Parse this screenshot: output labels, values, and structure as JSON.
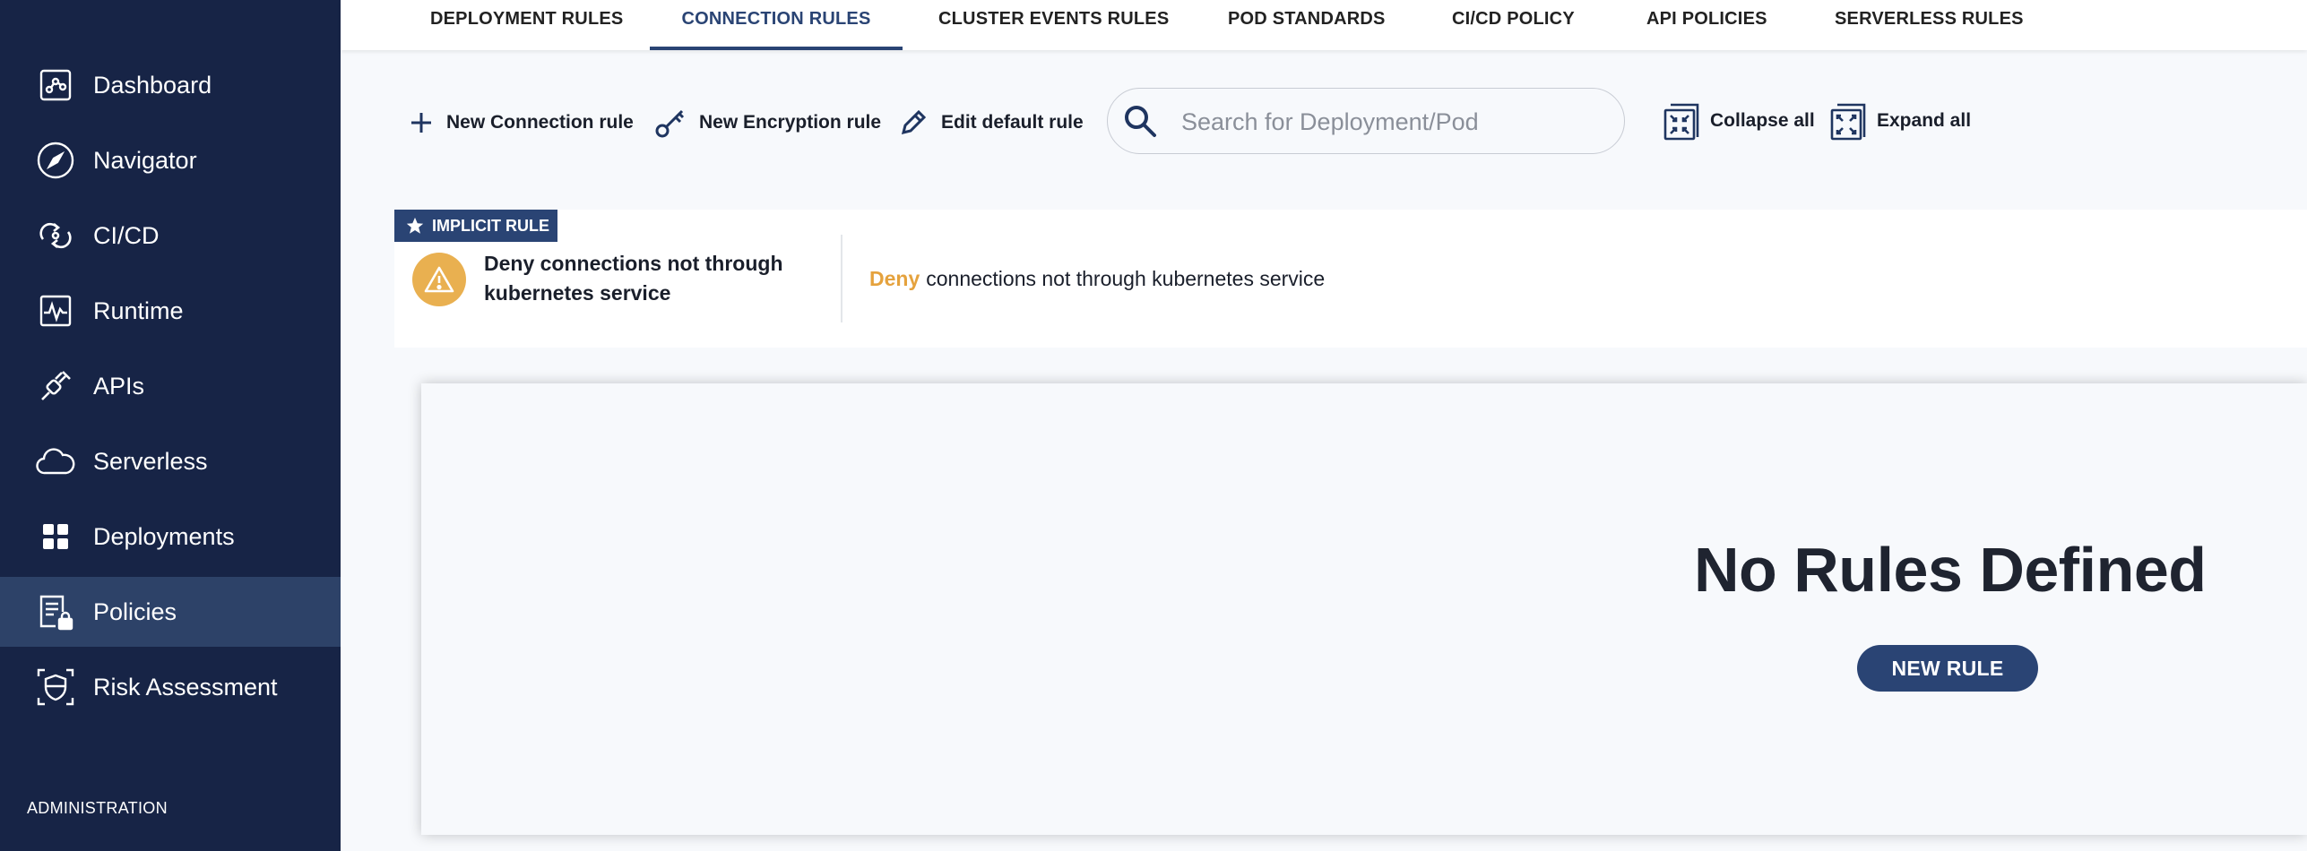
{
  "sidebar": {
    "items": [
      {
        "label": "Dashboard",
        "icon": "dashboard-icon"
      },
      {
        "label": "Navigator",
        "icon": "compass-icon"
      },
      {
        "label": "CI/CD",
        "icon": "cicd-icon"
      },
      {
        "label": "Runtime",
        "icon": "runtime-icon"
      },
      {
        "label": "APIs",
        "icon": "api-plug-icon"
      },
      {
        "label": "Serverless",
        "icon": "cloud-icon"
      },
      {
        "label": "Deployments",
        "icon": "grid-icon"
      },
      {
        "label": "Policies",
        "icon": "policy-lock-icon",
        "active": true
      },
      {
        "label": "Risk Assessment",
        "icon": "shield-scan-icon"
      }
    ],
    "admin_label": "ADMINISTRATION"
  },
  "tabs": [
    {
      "label": "DEPLOYMENT RULES"
    },
    {
      "label": "CONNECTION RULES",
      "active": true
    },
    {
      "label": "CLUSTER EVENTS RULES"
    },
    {
      "label": "POD STANDARDS"
    },
    {
      "label": "CI/CD POLICY"
    },
    {
      "label": "API POLICIES"
    },
    {
      "label": "SERVERLESS RULES"
    }
  ],
  "toolbar": {
    "new_connection_label": "New Connection rule",
    "new_encryption_label": "New Encryption rule",
    "edit_default_label": "Edit default rule",
    "search_placeholder": "Search for Deployment/Pod",
    "collapse_label": "Collapse all",
    "expand_label": "Expand all"
  },
  "implicit_rule": {
    "badge": "IMPLICIT RULE",
    "title": "Deny connections not through kubernetes service",
    "action": "Deny",
    "description": "connections not through kubernetes service"
  },
  "empty_state": {
    "title": "No Rules Defined",
    "button_label": "NEW RULE"
  },
  "colors": {
    "sidebar_bg": "#172446",
    "sidebar_active": "#2d4268",
    "accent": "#2a4474",
    "warning": "#e9b050",
    "deny": "#e5a23d"
  }
}
